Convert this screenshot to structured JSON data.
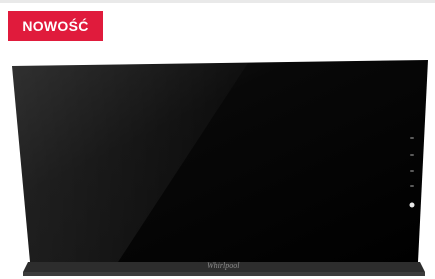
{
  "badge": {
    "label": "NOWOŚĆ",
    "color": "#e01b3c"
  },
  "product": {
    "brand": "Whirlpool",
    "panel_color": "#050505",
    "control_icons": [
      "touch-control-icon",
      "touch-control-icon",
      "touch-control-icon",
      "touch-control-icon",
      "touch-control-icon",
      "power-icon"
    ]
  }
}
